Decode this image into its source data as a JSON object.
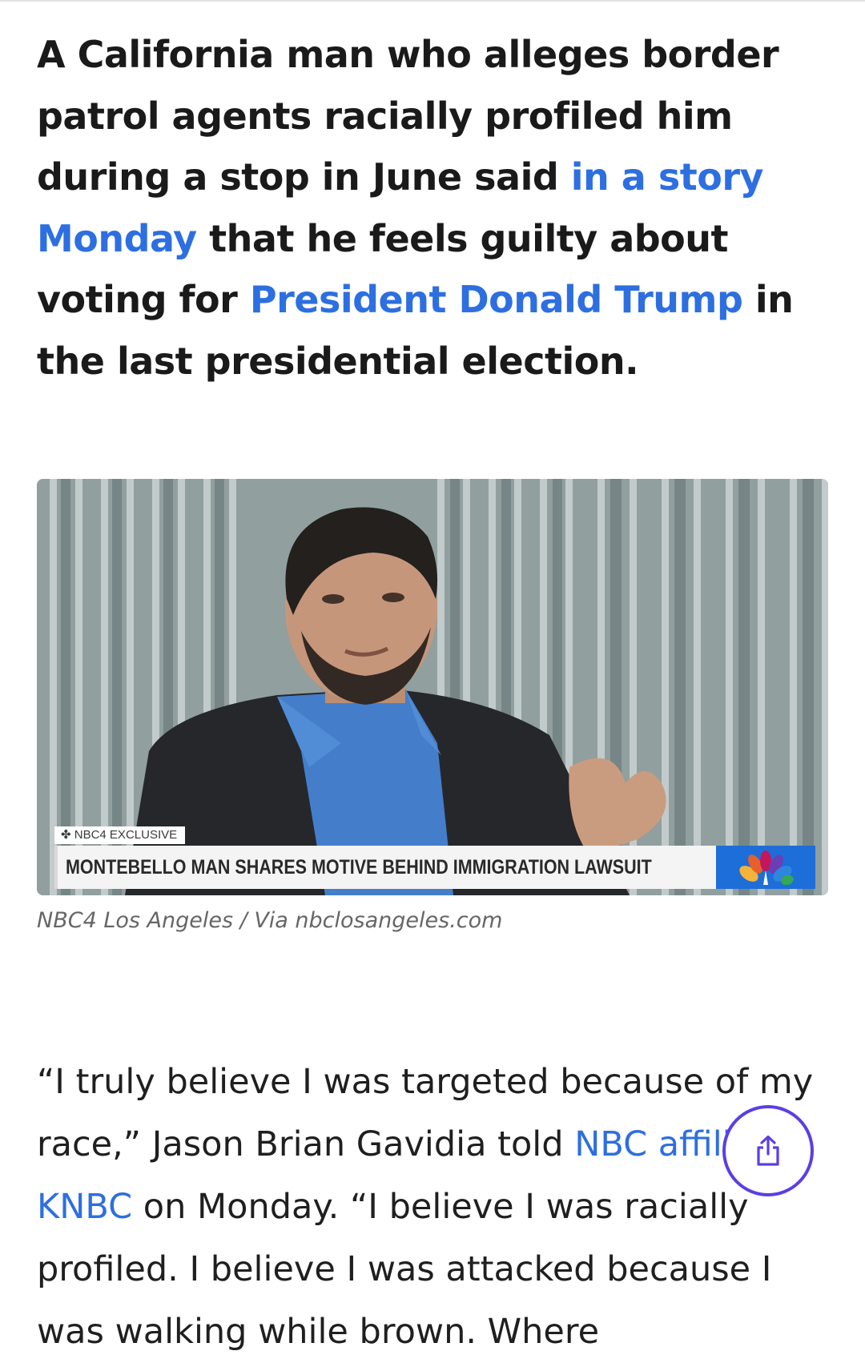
{
  "article": {
    "lede": {
      "p1": "A California man who alleges border patrol agents racially profiled him during a stop in June said ",
      "link1": "in a story Monday",
      "p2": " that he feels guilty about voting for ",
      "link2": "President Donald Trump",
      "p3": " in the last presidential election."
    },
    "media": {
      "tag": "NBC4 EXCLUSIVE",
      "chyron": "MONTEBELLO MAN SHARES MOTIVE BEHIND IMMIGRATION LAWSUIT",
      "caption": "NBC4 Los Angeles / Via nbclosangeles.com"
    },
    "body": {
      "p1": "“I truly believe I was targeted because of my race,” Jason Brian Gavidia told ",
      "link": "NBC affiliate KNBC",
      "p2": " on Monday. “I believe I was racially profiled. I believe I was attacked because I was walking while brown. Where"
    }
  },
  "share_button": {
    "icon": "share-icon"
  },
  "colors": {
    "link": "#2d6fe0",
    "share_ring": "#5b3ee6",
    "nbc_blue": "#1d6ed8"
  }
}
